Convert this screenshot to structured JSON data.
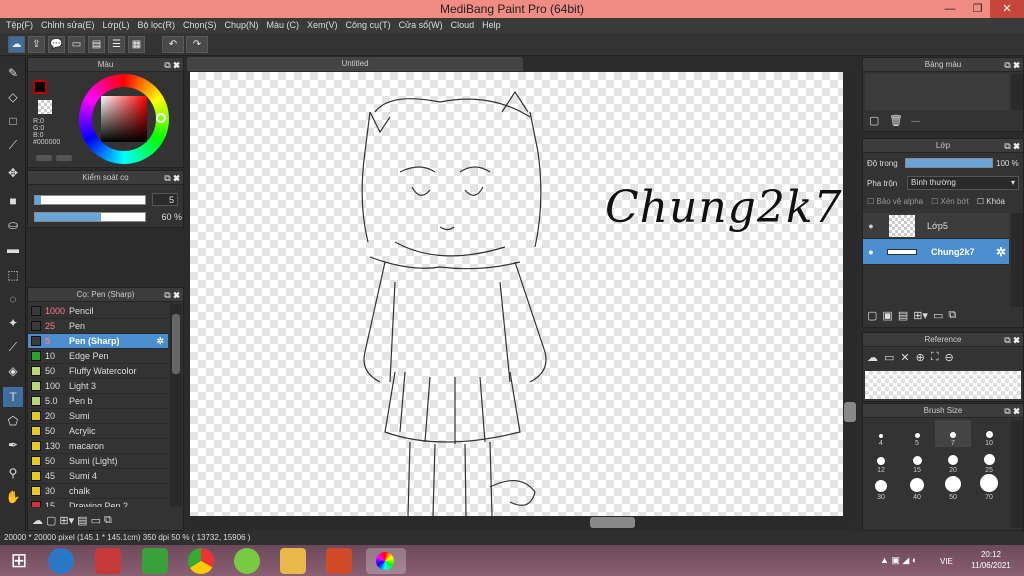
{
  "window": {
    "title": "MediBang Paint Pro (64bit)",
    "controls": [
      "—",
      "❐",
      "✕"
    ]
  },
  "menu": [
    "Tệp(F)",
    "Chỉnh sửa(E)",
    "Lớp(L)",
    "Bộ lọc(R)",
    "Chọn(S)",
    "Chụp(N)",
    "Màu (C)",
    "Xem(V)",
    "Công cụ(T)",
    "Cửa sổ(W)",
    "Cloud",
    "Help"
  ],
  "color_panel": {
    "title": "Màu",
    "r": "R:0",
    "g": "G:0",
    "b": "B:0",
    "hex": "#000000",
    "primary": "#000000",
    "accent": "#c00000"
  },
  "brush_control": {
    "title": "Kiểm soát cọ",
    "size": "5",
    "opacity": "60 %",
    "opacity_value": 0.6
  },
  "brush_list": {
    "title": "Cọ: Pen (Sharp)",
    "items": [
      {
        "size": "1000",
        "name": "Pencil",
        "color": "#3a3a3a"
      },
      {
        "size": "25",
        "name": "Pen",
        "color": "#3a3a3a"
      },
      {
        "size": "5",
        "name": "Pen (Sharp)",
        "color": "#3a3a3a"
      },
      {
        "size": "10",
        "name": "Edge Pen",
        "color": "#2aa52a"
      },
      {
        "size": "50",
        "name": "Fluffy Watercolor",
        "color": "#b8d870"
      },
      {
        "size": "100",
        "name": "Light 3",
        "color": "#b8d870"
      },
      {
        "size": "5.0",
        "name": "Pen b",
        "color": "#b8d870"
      },
      {
        "size": "20",
        "name": "Sumi",
        "color": "#e6cc1a"
      },
      {
        "size": "50",
        "name": "Acrylic",
        "color": "#e6cc1a"
      },
      {
        "size": "130",
        "name": "macaron",
        "color": "#e6cc1a"
      },
      {
        "size": "50",
        "name": "Sumi (Light)",
        "color": "#e6cc1a"
      },
      {
        "size": "45",
        "name": "Sumi 4",
        "color": "#e6cc1a"
      },
      {
        "size": "30",
        "name": "chalk",
        "color": "#e6cc1a"
      },
      {
        "size": "15",
        "name": "Drawing Pen 2",
        "color": "#d83030"
      }
    ]
  },
  "document": {
    "tab": "Untitled",
    "signature": "Chung2k7"
  },
  "palette_panel": {
    "title": "Bảng màu",
    "dash": "---"
  },
  "layer_panel": {
    "title": "Lớp",
    "opacity_label": "Độ trong",
    "opacity": "100 %",
    "blend_label": "Pha trộn",
    "blend": "Bình thường",
    "protect_alpha": "Bảo vệ alpha",
    "clipping": "Xén bớt",
    "lock": "Khóa",
    "layers": [
      {
        "name": "Lớp5",
        "selected": false
      },
      {
        "name": "Chung2k7",
        "selected": true
      }
    ]
  },
  "reference_panel": {
    "title": "Reference"
  },
  "brush_size_panel": {
    "title": "Brush Size",
    "sizes": [
      "4",
      "5",
      "7",
      "10",
      "12",
      "15",
      "20",
      "25",
      "30",
      "40",
      "50",
      "70"
    ]
  },
  "status": {
    "text": "20000 * 20000 pixel  (145.1 * 145.1cm)  350 dpi  50 %  ( 13732, 15906 )"
  },
  "taskbar": {
    "lang": "VIE",
    "time": "20:12",
    "date": "11/06/2021"
  }
}
